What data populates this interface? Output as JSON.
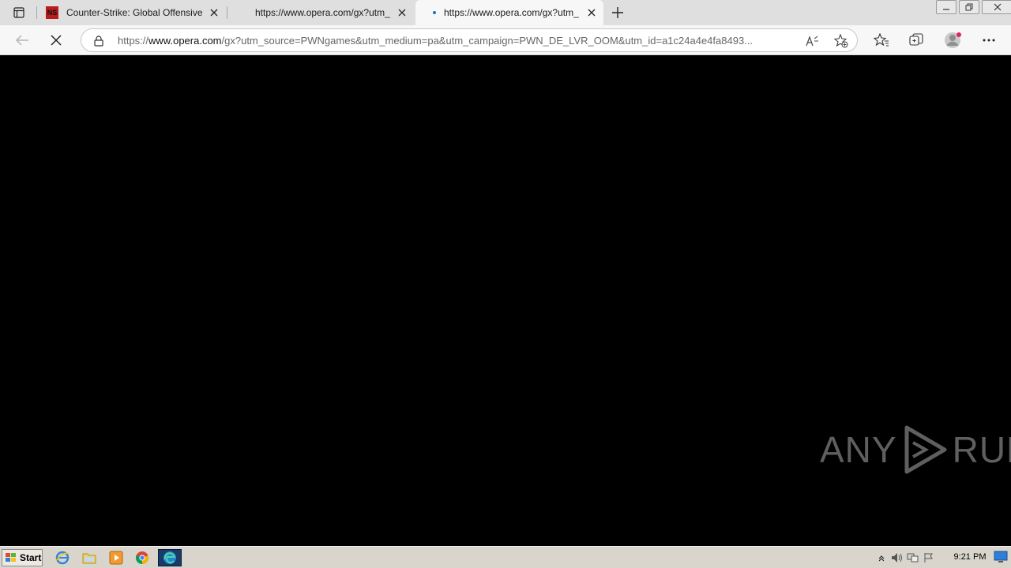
{
  "browser": {
    "tabs": [
      {
        "title": "Counter-Strike: Global Offensive",
        "favicon": "cs-favicon",
        "active": false
      },
      {
        "title": "https://www.opera.com/gx?utm_",
        "favicon": "none",
        "active": false
      },
      {
        "title": "https://www.opera.com/gx?utm_",
        "favicon": "loading-dot",
        "active": true
      }
    ],
    "address": {
      "prefix": "https://",
      "domain": "www.opera.com",
      "rest": "/gx?utm_source=PWNgames&utm_medium=pa&utm_campaign=PWN_DE_LVR_OOM&utm_id=a1c24a4e4fa8493..."
    }
  },
  "watermark": {
    "left": "ANY",
    "right": "RUN"
  },
  "taskbar": {
    "start_label": "Start",
    "clock": "9:21 PM"
  },
  "colors": {
    "page_background": "#000000",
    "taskbar": "#d9d5cc",
    "tabstrip": "#dfdfdf",
    "accent": "#1f6fd0"
  }
}
